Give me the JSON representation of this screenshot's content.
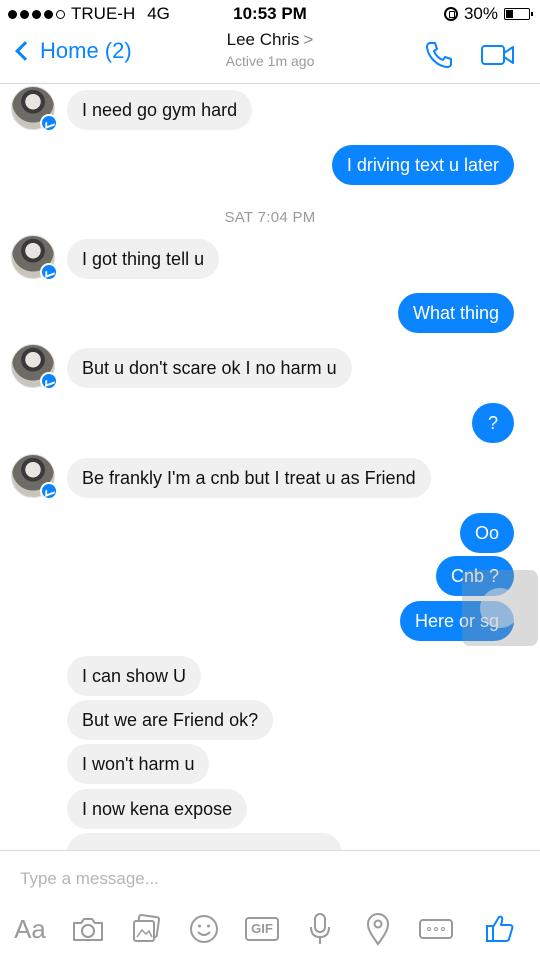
{
  "status_bar": {
    "carrier": "TRUE-H",
    "network": "4G",
    "time": "10:53 PM",
    "battery": "30%",
    "battery_level": 0.3
  },
  "nav": {
    "back_label": "Home (2)",
    "contact_name": "Lee Chris",
    "name_arrow": ">",
    "status": "Active 1m ago",
    "icons": [
      "phone-icon",
      "video-icon"
    ],
    "accent": "#0a84ff"
  },
  "messages": [
    {
      "dir": "in",
      "text": "I need go gym hard",
      "avatar": true
    },
    {
      "dir": "out",
      "text": "I driving text u later"
    },
    {
      "type": "time",
      "text": "SAT 7:04 PM"
    },
    {
      "dir": "in",
      "text": "I got thing tell u",
      "avatar": true
    },
    {
      "dir": "out",
      "text": "What thing"
    },
    {
      "dir": "in",
      "text": "But u don't scare ok I no harm u",
      "avatar": true
    },
    {
      "dir": "out",
      "text": "?"
    },
    {
      "dir": "in",
      "text": "Be frankly I'm a cnb but I treat u as Friend",
      "avatar": true
    },
    {
      "dir": "out",
      "text": "Oo"
    },
    {
      "dir": "out",
      "text": "Cnb ?"
    },
    {
      "dir": "out",
      "text": "Here or sg"
    },
    {
      "dir": "in",
      "text": "I can show U"
    },
    {
      "dir": "in",
      "text": "But we are Friend ok?"
    },
    {
      "dir": "in",
      "text": "I won't harm u"
    },
    {
      "dir": "in",
      "text": "I now kena expose"
    }
  ],
  "composer": {
    "placeholder": "Type a message...",
    "aa_label": "Aa",
    "gif_label": "GIF",
    "tools": [
      "aa-icon",
      "camera-icon",
      "photo-icon",
      "emoji-icon",
      "gif-icon",
      "microphone-icon",
      "location-icon",
      "more-icon",
      "thumbs-up-icon"
    ]
  }
}
